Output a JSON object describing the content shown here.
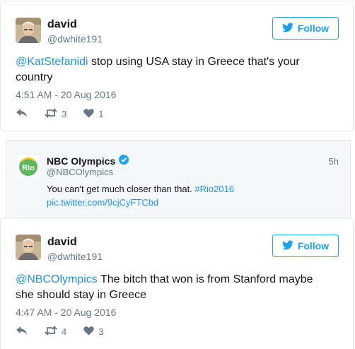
{
  "tweet1": {
    "name": "david",
    "handle": "@dwhite191",
    "follow_label": "Follow",
    "mention": "@KatStefanidi",
    "text": " stop using USA stay in Greece that's your country",
    "timestamp": "4:51 AM - 20 Aug 2016",
    "retweets": "3",
    "likes": "1"
  },
  "quoted": {
    "name": "NBC Olympics",
    "handle": "@NBCOlympics",
    "time": "5h",
    "text": "You can't get much closer than that. ",
    "hashtag": "#Rio2016",
    "link": "pic.twitter.com/9cjCyFTCbd",
    "logo_text": "Rio"
  },
  "tweet2": {
    "name": "david",
    "handle": "@dwhite191",
    "follow_label": "Follow",
    "mention": "@NBCOlympics",
    "text": " The bitch that won is from Stanford maybe she should stay in Greece",
    "timestamp": "4:47 AM - 20 Aug 2016",
    "retweets": "4",
    "likes": "3"
  },
  "colors": {
    "accent": "#1da1f2",
    "link": "#1b95e0",
    "muted": "#657786",
    "verified": "#1da1f2",
    "rio_green": "#5cb85c"
  }
}
